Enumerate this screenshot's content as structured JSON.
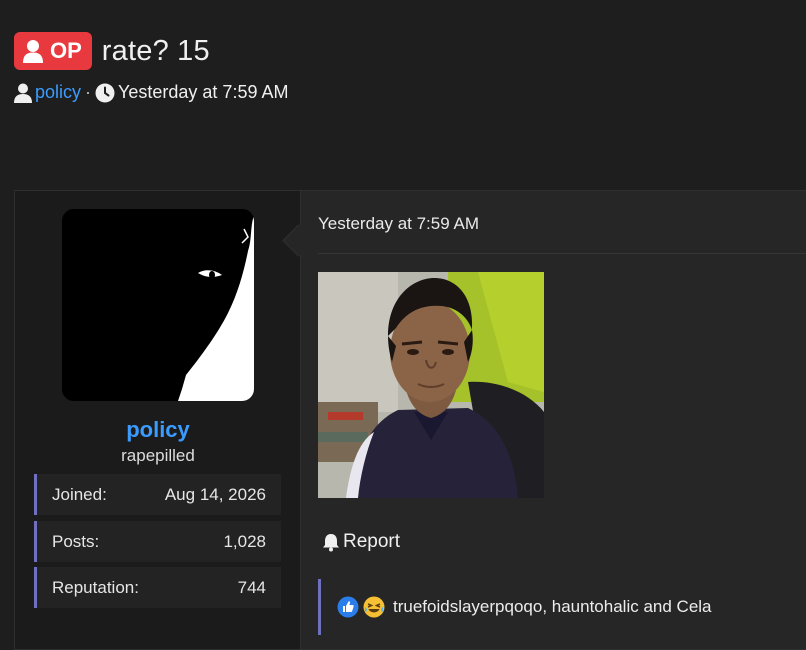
{
  "thread": {
    "badge_label": "OP",
    "title": "rate? 15",
    "author": "policy",
    "separator": "·",
    "date": "Yesterday at 7:59 AM"
  },
  "user": {
    "name": "policy",
    "title": "rapepilled",
    "stats": [
      {
        "label": "Joined:",
        "value": "Aug 14, 2026"
      },
      {
        "label": "Posts:",
        "value": "1,028"
      },
      {
        "label": "Reputation:",
        "value": "744"
      }
    ]
  },
  "post": {
    "date": "Yesterday at 7:59 AM",
    "report_label": "Report",
    "reactions_text": "truefoidslayerpqoqo, hauntohalic and Cela",
    "reaction_icons": [
      "like-icon",
      "laugh-icon"
    ]
  },
  "colors": {
    "accent_link": "#3b9cff",
    "op_badge": "#e8393f",
    "stat_border": "#6f70c0",
    "background": "#1e1e1f"
  }
}
